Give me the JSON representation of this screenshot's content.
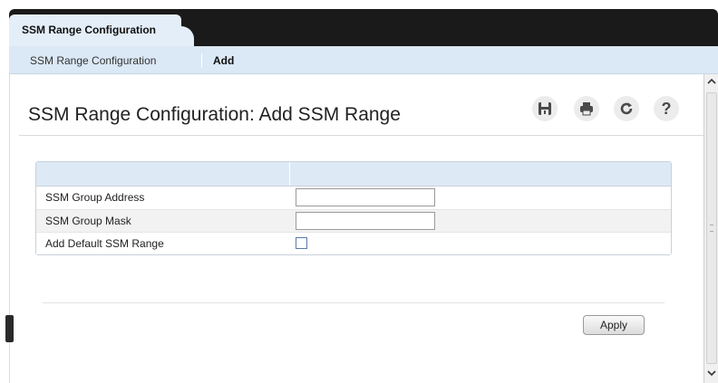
{
  "tabs": {
    "active_label": "SSM Range Configuration"
  },
  "subnav": {
    "items": [
      {
        "label": "SSM Range Configuration"
      },
      {
        "label": "Add"
      }
    ]
  },
  "page": {
    "title": "SSM Range Configuration: Add SSM Range"
  },
  "toolbar": {
    "icons": [
      "save-icon",
      "print-icon",
      "refresh-icon",
      "help-icon"
    ]
  },
  "form": {
    "rows": [
      {
        "label": "SSM Group Address",
        "value": ""
      },
      {
        "label": "SSM Group Mask",
        "value": ""
      },
      {
        "label": "Add Default SSM Range",
        "checked": false
      }
    ]
  },
  "actions": {
    "apply_label": "Apply"
  },
  "colors": {
    "tab_bar": "#1a1a1a",
    "subnav": "#dbe8f5",
    "table_header": "#dde9f5"
  }
}
